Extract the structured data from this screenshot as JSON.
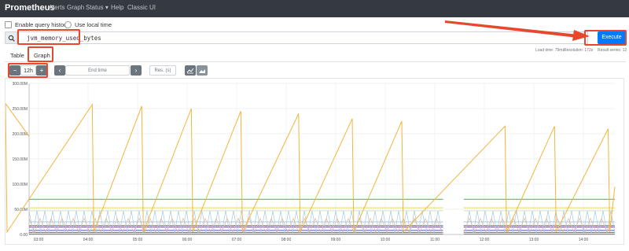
{
  "nav": {
    "brand": "Prometheus",
    "items": [
      "Alerts",
      "Graph",
      "Status ▾",
      "Help",
      "Classic UI"
    ]
  },
  "options": {
    "enable_query_history": "Enable query history",
    "use_local_time": "Use local time"
  },
  "query": {
    "value": "jvm_memory_used_bytes",
    "execute_label": "Execute"
  },
  "stats": {
    "load_time": "Load time: 79ms",
    "resolution": "Resolution: 172s",
    "result_series": "Result series: 12"
  },
  "tabs": [
    "Table",
    "Graph"
  ],
  "controls": {
    "minus": "−",
    "range": "12h",
    "plus": "+",
    "prev": "‹",
    "end_time_placeholder": "End time",
    "next": "›",
    "resolution_placeholder": "Res. (s)",
    "line_chart_icon": "line-chart-icon",
    "stacked_chart_icon": "stacked-chart-icon"
  },
  "chart_data": {
    "type": "line",
    "yticks": [
      "300.00M",
      "250.00M",
      "200.00M",
      "150.00M",
      "100.00M",
      "50.00M",
      "0.00"
    ],
    "xticks": [
      "03:00",
      "04:00",
      "05:00",
      "06:00",
      "07:00",
      "08:00",
      "09:00",
      "10:00",
      "11:00",
      "12:00",
      "13:00",
      "14:00"
    ],
    "ylim": [
      0,
      300
    ],
    "gap": [
      "11:10",
      "11:35"
    ],
    "sawtooth_peaks": [
      {
        "t": "02:20",
        "v": 260
      },
      {
        "t": "04:05",
        "v": 258
      },
      {
        "t": "05:05",
        "v": 255
      },
      {
        "t": "06:05",
        "v": 250
      },
      {
        "t": "07:05",
        "v": 245
      },
      {
        "t": "08:15",
        "v": 240
      },
      {
        "t": "09:20",
        "v": 230
      },
      {
        "t": "10:20",
        "v": 225
      },
      {
        "t": "12:25",
        "v": 215
      },
      {
        "t": "13:25",
        "v": 215
      },
      {
        "t": "14:30",
        "v": 210
      }
    ],
    "series": [
      {
        "values_desc": "sawtooth",
        "color": "#f2b53e"
      },
      {
        "level": 70,
        "color": "#4caf50"
      },
      {
        "level": 53,
        "color": "#e6d95a"
      },
      {
        "level": 47,
        "color": "#cfe6b4"
      },
      {
        "level": 25,
        "color": "#a6c8e8"
      },
      {
        "level": 18,
        "color": "#8a8a8a"
      },
      {
        "level": 15,
        "color": "#5d2d8a"
      },
      {
        "level": 8,
        "color": "#3f5ab5"
      },
      {
        "level": 4,
        "color": "#e24b5a"
      },
      {
        "level": 1,
        "color": "#7a7a7a"
      }
    ],
    "grid": true
  }
}
